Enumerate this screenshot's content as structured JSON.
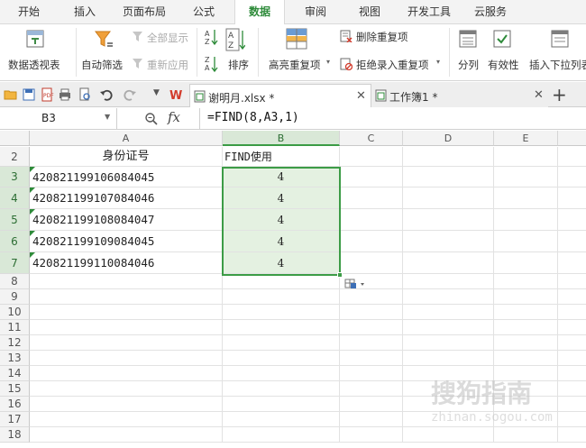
{
  "menu_tabs": [
    "开始",
    "插入",
    "页面布局",
    "公式",
    "数据",
    "审阅",
    "视图",
    "开发工具",
    "云服务"
  ],
  "active_menu_tab": "数据",
  "ribbon": {
    "pivot_table": "数据透视表",
    "auto_filter": "自动筛选",
    "show_all": "全部显示",
    "reapply": "重新应用",
    "sort": "排序",
    "sort_az": "A Z",
    "highlight_duplicates": "高亮重复项",
    "remove_duplicates": "删除重复项",
    "reject_duplicates": "拒绝录入重复项",
    "split": "分列",
    "validity": "有效性",
    "insert_dropdown": "插入下拉列表"
  },
  "doc_tabs": [
    {
      "name": "谢明月.xlsx *",
      "active": true
    },
    {
      "name": "工作簿1 *",
      "active": false
    }
  ],
  "formula_bar": {
    "cell_ref": "B3",
    "fx": "fx",
    "formula": "=FIND(8,A3,1)"
  },
  "columns": [
    "A",
    "B",
    "C",
    "D",
    "E"
  ],
  "selected_column": "B",
  "row_numbers": [
    "2",
    "3",
    "4",
    "5",
    "6",
    "7",
    "8",
    "9",
    "10",
    "11",
    "12",
    "13",
    "14",
    "15",
    "16",
    "17",
    "18"
  ],
  "selected_rows": [
    "3",
    "4",
    "5",
    "6",
    "7"
  ],
  "header_row": {
    "a": "身份证号",
    "b": "FIND使用"
  },
  "data_rows": [
    {
      "id": "420821199106084045",
      "find": "4"
    },
    {
      "id": "420821199107084046",
      "find": "4"
    },
    {
      "id": "420821199108084047",
      "find": "4"
    },
    {
      "id": "420821199109084045",
      "find": "4"
    },
    {
      "id": "420821199110084046",
      "find": "4"
    }
  ],
  "watermark": {
    "text": "搜狗指南",
    "url": "zhinan.sogou.com"
  },
  "colors": {
    "accent": "#2e8b3a",
    "selection": "#3c9c46",
    "selected_fill": "#e4f1e1"
  }
}
